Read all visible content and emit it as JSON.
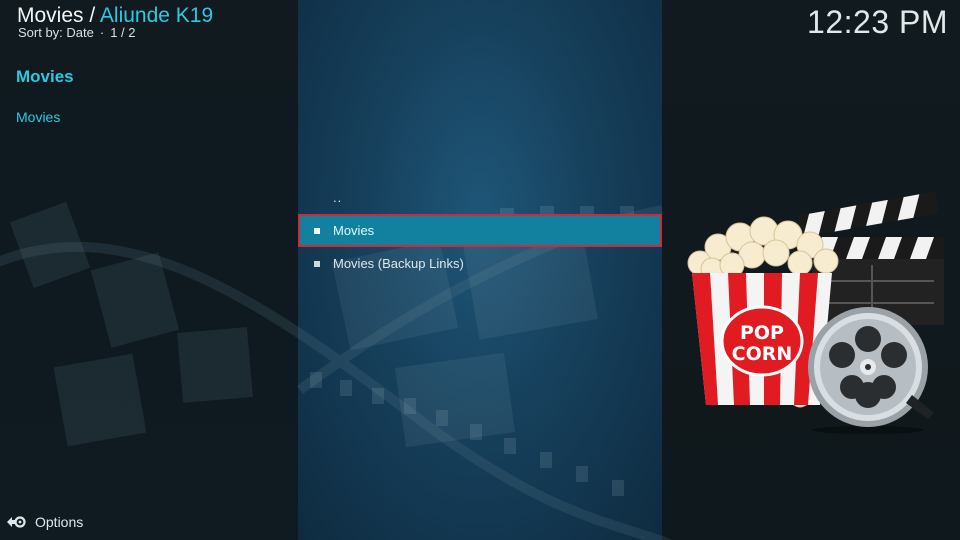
{
  "header": {
    "crumb_root": "Movies",
    "crumb_separator": " / ",
    "crumb_current": "Aliunde K19",
    "sort_label": "Sort by: Date",
    "page_indicator": "1 / 2",
    "dot": "·",
    "clock": "12:23 PM"
  },
  "sidebar": {
    "title": "Movies",
    "item": "Movies"
  },
  "list": {
    "parent_label": "..",
    "items": [
      {
        "label": "Movies",
        "selected": true
      },
      {
        "label": "Movies (Backup Links)",
        "selected": false
      }
    ]
  },
  "footer": {
    "options_label": "Options",
    "options_icon": "settings-arrow-icon"
  },
  "artwork": {
    "icon": "popcorn-clapperboard-film-reel-icon",
    "popcorn_box_text_line1": "POP",
    "popcorn_box_text_line2": "CORN"
  },
  "colors": {
    "accent": "#2ec9e0",
    "selection": "#12819f",
    "selection_border": "#d2283a"
  }
}
